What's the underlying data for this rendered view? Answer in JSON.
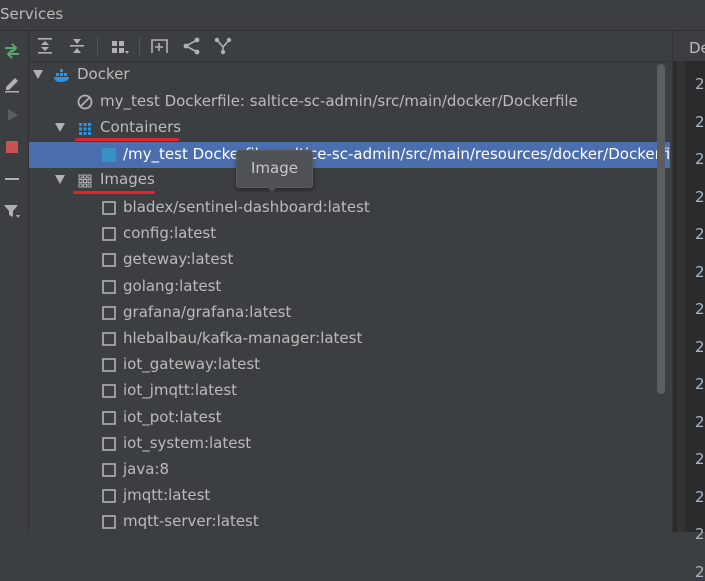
{
  "window": {
    "title": "Services"
  },
  "toolbar": {
    "buttons": [
      "expand-all-icon",
      "collapse-all-icon",
      "group-by-icon",
      "new-tab-icon",
      "share-icon",
      "filter-branch-icon"
    ]
  },
  "tree": {
    "docker_label": "Docker",
    "dockerfile_item": "my_test Dockerfile: saltice-sc-admin/src/main/docker/Dockerfile",
    "containers_label": "Containers",
    "container_item": "/my_test Dockerfile: saltice-sc-admin/src/main/resources/docker/Dockerfile",
    "images_label": "Images",
    "images": [
      "bladex/sentinel-dashboard:latest",
      "config:latest",
      "geteway:latest",
      "golang:latest",
      "grafana/grafana:latest",
      "hlebalbau/kafka-manager:latest",
      "iot_gateway:latest",
      "iot_jmqtt:latest",
      "iot_pot:latest",
      "iot_system:latest",
      "java:8",
      "jmqtt:latest",
      "mqtt-server:latest"
    ]
  },
  "tooltip": {
    "text": "Image"
  },
  "right_panel": {
    "header_text": "De",
    "line_digits": [
      "2",
      "2",
      "2",
      "2",
      "2",
      "2",
      "2",
      "2",
      "2",
      "2",
      "2",
      "2",
      "2",
      "2"
    ]
  },
  "colors": {
    "background": "#3c3f41",
    "selection": "#4b6eaf",
    "annotation_red": "#e0262b",
    "docker_blue": "#2496ed",
    "editor_bg": "#2b2b2b"
  }
}
